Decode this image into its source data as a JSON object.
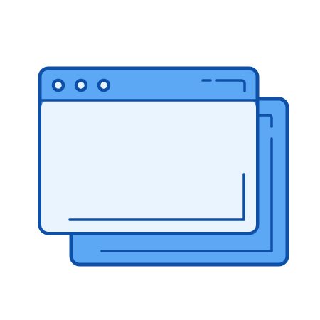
{
  "icon": {
    "name": "multiple-browser-windows-icon",
    "colors": {
      "stroke": "#0E4FA8",
      "frame_fill": "#5DA8F5",
      "content_fill": "#EAF4FE",
      "highlight": "#0E4FA8"
    }
  },
  "front_window": {
    "window_controls": [
      "close-dot",
      "minimize-dot",
      "maximize-dot"
    ]
  }
}
